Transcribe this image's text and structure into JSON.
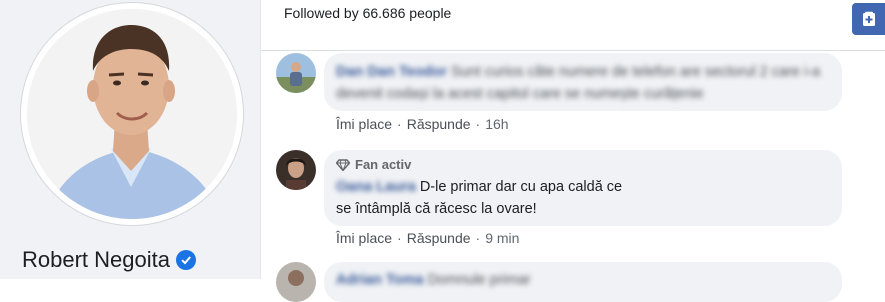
{
  "profile": {
    "name": "Robert Negoita",
    "verified_icon": "verified-check-icon"
  },
  "header": {
    "followers_text": "Followed by 66.686 people",
    "add_button_icon": "add-to-page-icon"
  },
  "comments": [
    {
      "author": "Dan Dan Teodor",
      "text_blurred": "Sunt curios câte numere de telefon are sectorul 2 care i-a devenit codași la acest capitol care se numește curățenie",
      "actions": {
        "like": "Îmi place",
        "reply": "Răspunde",
        "time": "16h"
      }
    },
    {
      "badge": "Fan activ",
      "badge_icon": "diamond-icon",
      "author": "Oana Laura",
      "text_visible": "D-le primar dar cu apa caldă ce se întâmplă că răcesc la ovare!",
      "actions": {
        "like": "Îmi place",
        "reply": "Răspunde",
        "time": "9 min"
      }
    },
    {
      "author": "Adrian Toma",
      "text_blurred": "Domnule primar"
    }
  ],
  "colors": {
    "link": "#385898",
    "sidebar_bg": "#f0f2f5",
    "bubble_bg": "#f0f2f5",
    "verified": "#1b74e4",
    "button": "#4267b2"
  }
}
